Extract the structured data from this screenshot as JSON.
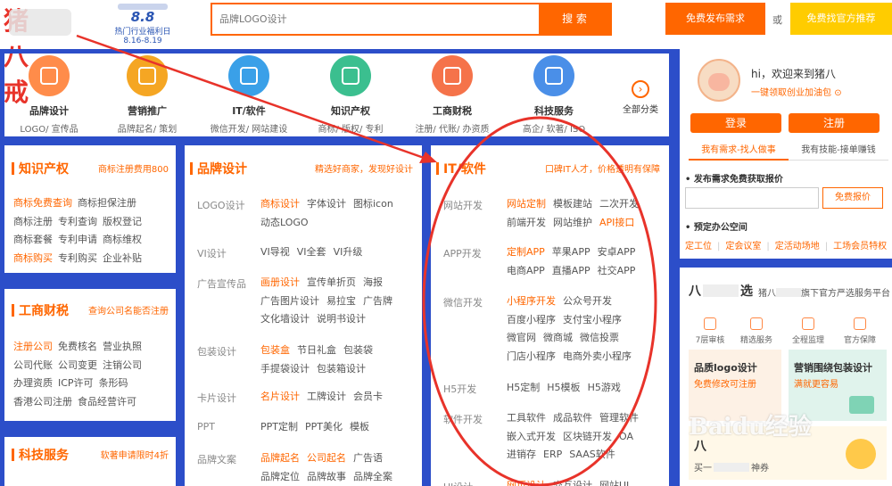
{
  "header": {
    "logo_text": "猪八戒",
    "promo_big": "8.8",
    "promo_line1": "热门行业福利日",
    "promo_line2": "8.16-8.19",
    "search_placeholder": "品牌LOGO设计",
    "search_btn": "搜 索",
    "publish_btn": "免费发布需求",
    "or_text": "或",
    "find_btn": "免费找官方推荐"
  },
  "categories": [
    {
      "name": "品牌设计",
      "sub": "LOGO/ 宣传品",
      "icon": "brand-design-icon",
      "color": "#ff8c4a"
    },
    {
      "name": "营销推广",
      "sub": "品牌起名/ 策划",
      "icon": "megaphone-icon",
      "color": "#f5a623"
    },
    {
      "name": "IT/软件",
      "sub": "微信开发/ 网站建设",
      "icon": "code-monitor-icon",
      "color": "#3aa0e8"
    },
    {
      "name": "知识产权",
      "sub": "商标/ 版权/ 专利",
      "icon": "registered-trademark-icon",
      "color": "#3bbf8f"
    },
    {
      "name": "工商财税",
      "sub": "注册/ 代账/ 办资质",
      "icon": "calculator-icon",
      "color": "#f5734a"
    },
    {
      "name": "科技服务",
      "sub": "高企/ 软著/ ISO",
      "icon": "tech-service-icon",
      "color": "#4a8fe8"
    }
  ],
  "all_categories": "全部分类",
  "ip_panel": {
    "title": "知识产权",
    "link": "商标注册费用800",
    "rows": [
      [
        {
          "t": "商标免费查询",
          "o": true
        },
        {
          "t": "商标担保注册",
          "o": false
        }
      ],
      [
        {
          "t": "商标注册",
          "o": false
        },
        {
          "t": "专利查询",
          "o": false
        },
        {
          "t": "版权登记",
          "o": false
        }
      ],
      [
        {
          "t": "商标套餐",
          "o": false
        },
        {
          "t": "专利申请",
          "o": false
        },
        {
          "t": "商标维权",
          "o": false
        }
      ],
      [
        {
          "t": "商标购买",
          "o": true
        },
        {
          "t": "专利购买",
          "o": false
        },
        {
          "t": "企业补贴",
          "o": false
        }
      ]
    ]
  },
  "biz_panel": {
    "title": "工商财税",
    "link": "查询公司名能否注册",
    "rows": [
      [
        {
          "t": "注册公司",
          "o": true
        },
        {
          "t": "免费核名",
          "o": false
        },
        {
          "t": "营业执照",
          "o": false
        }
      ],
      [
        {
          "t": "公司代账",
          "o": false
        },
        {
          "t": "公司变更",
          "o": false
        },
        {
          "t": "注销公司",
          "o": false
        }
      ],
      [
        {
          "t": "办理资质",
          "o": false
        },
        {
          "t": "ICP许可",
          "o": false
        },
        {
          "t": "条形码",
          "o": false
        }
      ],
      [
        {
          "t": "香港公司注册",
          "o": false
        },
        {
          "t": "食品经营许可",
          "o": false
        }
      ]
    ]
  },
  "tech_panel": {
    "title": "科技服务",
    "link": "软著申请限时4折"
  },
  "brand_panel": {
    "title": "品牌设计",
    "link": "精选好商家，发现好设计",
    "groups": [
      {
        "name": "LOGO设计",
        "lines": [
          [
            {
              "t": "商标设计",
              "o": true
            },
            {
              "t": "字体设计",
              "o": false
            },
            {
              "t": "图标icon",
              "o": false
            }
          ],
          [
            {
              "t": "动态LOGO",
              "o": false
            }
          ]
        ]
      },
      {
        "name": "VI设计",
        "lines": [
          [
            {
              "t": "VI导视",
              "o": false
            },
            {
              "t": "VI全套",
              "o": false
            },
            {
              "t": "VI升级",
              "o": false
            }
          ]
        ]
      },
      {
        "name": "广告宣传品",
        "lines": [
          [
            {
              "t": "画册设计",
              "o": true
            },
            {
              "t": "宣传单折页",
              "o": false
            },
            {
              "t": "海报",
              "o": false
            }
          ],
          [
            {
              "t": "广告图片设计",
              "o": false
            },
            {
              "t": "易拉宝",
              "o": false
            },
            {
              "t": "广告牌",
              "o": false
            }
          ],
          [
            {
              "t": "文化墙设计",
              "o": false
            },
            {
              "t": "说明书设计",
              "o": false
            }
          ]
        ]
      },
      {
        "name": "包装设计",
        "lines": [
          [
            {
              "t": "包装盒",
              "o": true
            },
            {
              "t": "节日礼盒",
              "o": false
            },
            {
              "t": "包装袋",
              "o": false
            }
          ],
          [
            {
              "t": "手提袋设计",
              "o": false
            },
            {
              "t": "包装箱设计",
              "o": false
            }
          ]
        ]
      },
      {
        "name": "卡片设计",
        "lines": [
          [
            {
              "t": "名片设计",
              "o": true
            },
            {
              "t": "工牌设计",
              "o": false
            },
            {
              "t": "会员卡",
              "o": false
            }
          ]
        ]
      },
      {
        "name": "PPT",
        "lines": [
          [
            {
              "t": "PPT定制",
              "o": false
            },
            {
              "t": "PPT美化",
              "o": false
            },
            {
              "t": "模板",
              "o": false
            }
          ]
        ]
      },
      {
        "name": "品牌文案",
        "lines": [
          [
            {
              "t": "品牌起名",
              "o": true
            },
            {
              "t": "公司起名",
              "o": true
            },
            {
              "t": "广告语",
              "o": false
            }
          ],
          [
            {
              "t": "品牌定位",
              "o": false
            },
            {
              "t": "品牌故事",
              "o": false
            },
            {
              "t": "品牌全案",
              "o": false
            }
          ]
        ]
      }
    ]
  },
  "it_panel": {
    "title": "IT/软件",
    "link": "口碑IT人才，价格透明有保障",
    "groups": [
      {
        "name": "网站开发",
        "lines": [
          [
            {
              "t": "网站定制",
              "o": true
            },
            {
              "t": "模板建站",
              "o": false
            },
            {
              "t": "二次开发",
              "o": false
            }
          ],
          [
            {
              "t": "前端开发",
              "o": false
            },
            {
              "t": "网站维护",
              "o": false
            },
            {
              "t": "API接口",
              "o": true
            }
          ]
        ]
      },
      {
        "name": "APP开发",
        "lines": [
          [
            {
              "t": "定制APP",
              "o": true
            },
            {
              "t": "苹果APP",
              "o": false
            },
            {
              "t": "安卓APP",
              "o": false
            }
          ],
          [
            {
              "t": "电商APP",
              "o": false
            },
            {
              "t": "直播APP",
              "o": false
            },
            {
              "t": "社交APP",
              "o": false
            }
          ]
        ]
      },
      {
        "name": "微信开发",
        "lines": [
          [
            {
              "t": "小程序开发",
              "o": true
            },
            {
              "t": "公众号开发",
              "o": false
            }
          ],
          [
            {
              "t": "百度小程序",
              "o": false
            },
            {
              "t": "支付宝小程序",
              "o": false
            }
          ],
          [
            {
              "t": "微官网",
              "o": false
            },
            {
              "t": "微商城",
              "o": false
            },
            {
              "t": "微信投票",
              "o": false
            }
          ],
          [
            {
              "t": "门店小程序",
              "o": false
            },
            {
              "t": "电商外卖小程序",
              "o": false
            }
          ]
        ]
      },
      {
        "name": "H5开发",
        "lines": [
          [
            {
              "t": "H5定制",
              "o": false
            },
            {
              "t": "H5模板",
              "o": false
            },
            {
              "t": "H5游戏",
              "o": false
            }
          ]
        ]
      },
      {
        "name": "软件开发",
        "lines": [
          [
            {
              "t": "工具软件",
              "o": false
            },
            {
              "t": "成品软件",
              "o": false
            },
            {
              "t": "管理软件",
              "o": false
            }
          ],
          [
            {
              "t": "嵌入式开发",
              "o": false
            },
            {
              "t": "区块链开发",
              "o": false
            },
            {
              "t": "OA",
              "o": false
            }
          ],
          [
            {
              "t": "进销存",
              "o": false
            },
            {
              "t": "ERP",
              "o": false
            },
            {
              "t": "SAAS软件",
              "o": false
            }
          ]
        ]
      },
      {
        "name": "UI设计",
        "lines": [
          [
            {
              "t": "网页设计",
              "o": true
            },
            {
              "t": "交互设计",
              "o": false
            },
            {
              "t": "网站UI",
              "o": false
            }
          ]
        ]
      }
    ]
  },
  "sidebar": {
    "greeting": "hi，欢迎来到猪八",
    "vip_link": "一键领取创业加油包",
    "login": "登录",
    "register": "注册",
    "tab_need": "我有需求-找人做事",
    "tab_skill": "我有技能-接单赚钱",
    "quote_title": "发布需求免费获取报价",
    "quote_btn": "免费报价",
    "office_title": "预定办公空间",
    "office_links": [
      "定工位",
      "定会议室",
      "定活动场地",
      "工场会员特权"
    ],
    "select_title": "八",
    "select_title2": "选",
    "select_sub": "猪八",
    "select_sub2": "旗下官方严选服务平台",
    "services": [
      "7层审核",
      "精选服务",
      "全程监理",
      "官方保障"
    ],
    "ad1_title": "品质logo设计",
    "ad1_sub": "免费修改可注册",
    "ad2_title": "营销围绕包装设计",
    "ad2_sub": "满就更容易",
    "ad3_title": "八",
    "ad3_sub": "买一",
    "ad3_sub2": "神券",
    "watermark": "Baidu经验"
  }
}
